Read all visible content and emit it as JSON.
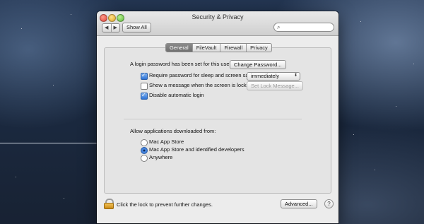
{
  "window": {
    "title": "Security & Privacy",
    "show_all_label": "Show All",
    "back_glyph": "◀",
    "forward_glyph": "▶",
    "search_placeholder": ""
  },
  "tabs": [
    {
      "label": "General",
      "active": true
    },
    {
      "label": "FileVault",
      "active": false
    },
    {
      "label": "Firewall",
      "active": false
    },
    {
      "label": "Privacy",
      "active": false
    }
  ],
  "general": {
    "login_password_text": "A login password has been set for this user",
    "change_password_label": "Change Password...",
    "require_password": {
      "label": "Require password for sleep and screen saver",
      "checked": true
    },
    "require_password_delay": "immediately",
    "show_message": {
      "label": "Show a message when the screen is locked",
      "checked": false
    },
    "set_lock_message_label": "Set Lock Message...",
    "disable_auto_login": {
      "label": "Disable automatic login",
      "checked": true
    },
    "allow_apps_heading": "Allow applications downloaded from:",
    "allow_options": [
      {
        "label": "Mac App Store",
        "selected": false
      },
      {
        "label": "Mac App Store and identified developers",
        "selected": true
      },
      {
        "label": "Anywhere",
        "selected": false
      }
    ]
  },
  "footer": {
    "lock_text": "Click the lock to prevent further changes.",
    "advanced_label": "Advanced...",
    "help_glyph": "?"
  },
  "icons": {
    "search": "search-icon",
    "lock": "lock-icon",
    "help": "help-icon"
  },
  "colors": {
    "accent": "#2e73d6",
    "active_tab": "#7a7a7a",
    "lock": "#e0a82e"
  }
}
